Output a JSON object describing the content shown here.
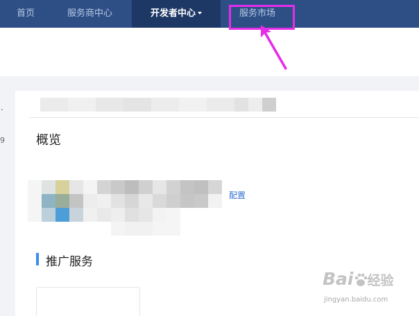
{
  "topnav": {
    "items": [
      {
        "label": "首页",
        "active": false
      },
      {
        "label": "服务商中心",
        "active": false
      },
      {
        "label": "开发者中心",
        "active": true,
        "has_dropdown": true
      },
      {
        "label": "服务市场",
        "active": false,
        "highlighted": true
      }
    ]
  },
  "sidebar": {
    "dot": ".",
    "number": "9"
  },
  "main": {
    "overview_title": "概览",
    "configure_link": "配置",
    "promo_section_title": "推广服务"
  },
  "watermark": {
    "logo": "Bai",
    "logo_suffix": "经验",
    "url": "jingyan.baidu.com"
  },
  "colors": {
    "nav_bg": "#2d4f86",
    "nav_active_bg": "#1e3866",
    "highlight": "#e62ce8",
    "link": "#2e6fd2",
    "section_accent": "#3a8cf0"
  }
}
